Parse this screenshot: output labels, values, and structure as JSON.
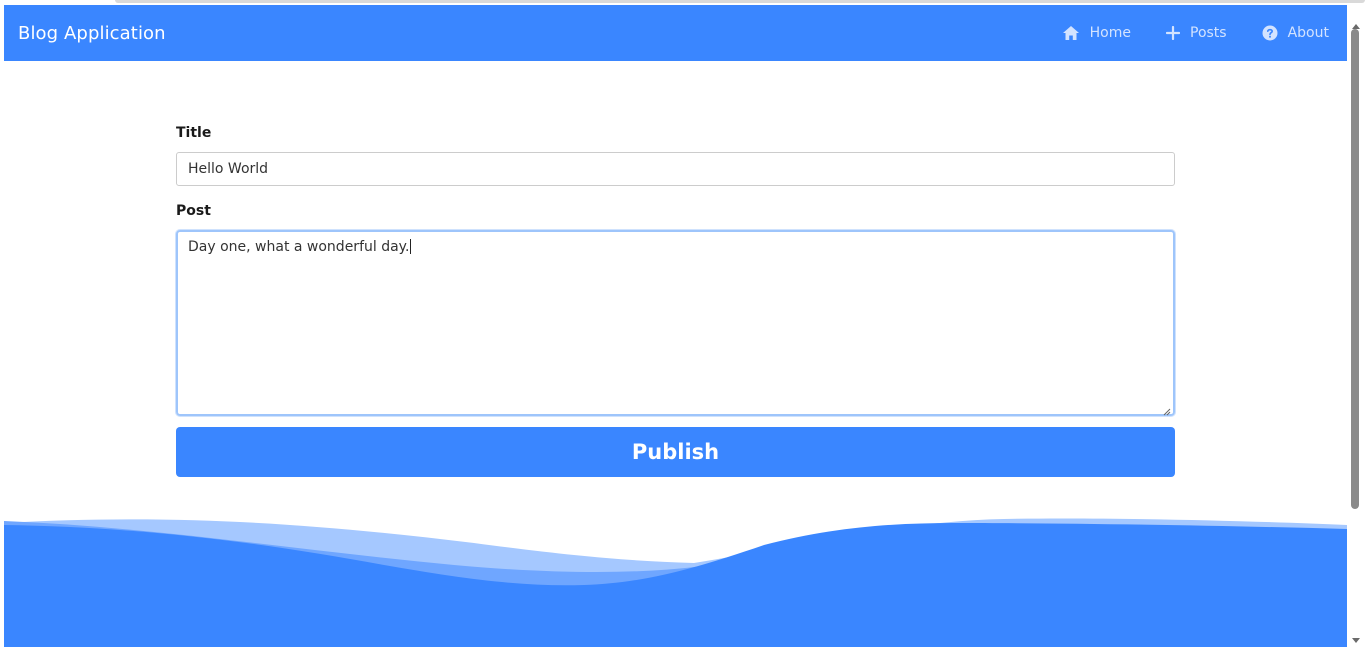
{
  "app": {
    "title": "Blog Application"
  },
  "nav": {
    "items": [
      {
        "label": "Home",
        "icon": "home-icon"
      },
      {
        "label": "Posts",
        "icon": "plus-icon"
      },
      {
        "label": "About",
        "icon": "question-circle-icon"
      }
    ]
  },
  "form": {
    "title_label": "Title",
    "title_value": "Hello World",
    "post_label": "Post",
    "post_value": "Day one, what a wonderful day.",
    "publish_label": "Publish"
  },
  "colors": {
    "accent": "#3a86ff",
    "nav_link": "#d3e3ff"
  }
}
